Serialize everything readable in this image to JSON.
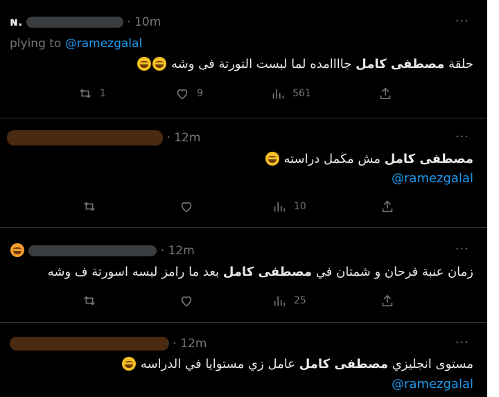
{
  "tweets": [
    {
      "handle_visible": "ɴ.",
      "time": "· 10m",
      "replying_prefix": "plying to",
      "replying_mention": "@ramezgalal",
      "text_pre": "حلقة ",
      "text_bold": "مصطفى كامل",
      "text_post": " جاااامده لما لبست التورتة فى وشه",
      "mention_line": "",
      "retweets": "1",
      "likes": "9",
      "views": "561"
    },
    {
      "time": "· 12m",
      "text_pre": "",
      "text_bold": "مصطفى كامل",
      "text_post": " مش مكمل دراسته",
      "mention_line": "@ramezgalal",
      "retweets": "",
      "likes": "",
      "views": "10"
    },
    {
      "time": "· 12m",
      "text_pre": "زمان عنبة فرحان و شمتان في ",
      "text_bold": "مصطفى كامل",
      "text_post": " بعد ما رامز لبسه اسورتة ف وشه",
      "mention_line": "",
      "retweets": "",
      "likes": "",
      "views": "25"
    },
    {
      "time": "· 12m",
      "text_pre": "مستوى انجليزي ",
      "text_bold": "مصطفى كامل",
      "text_post": " عامل زي مستوايا في الدراسه",
      "mention_line": "@ramezgalal",
      "retweets": "",
      "likes": "",
      "views": ""
    }
  ],
  "icons": {
    "more": "more-icon",
    "reply_count_icon": "retweet-icon",
    "like": "heart-icon",
    "views": "views-icon",
    "share": "share-icon",
    "emoji": "laughing-emoji-icon"
  },
  "colors": {
    "background": "#000000",
    "text": "#e7e9ea",
    "muted": "#71767b",
    "link": "#1d9bf0",
    "divider": "#2f3336"
  }
}
